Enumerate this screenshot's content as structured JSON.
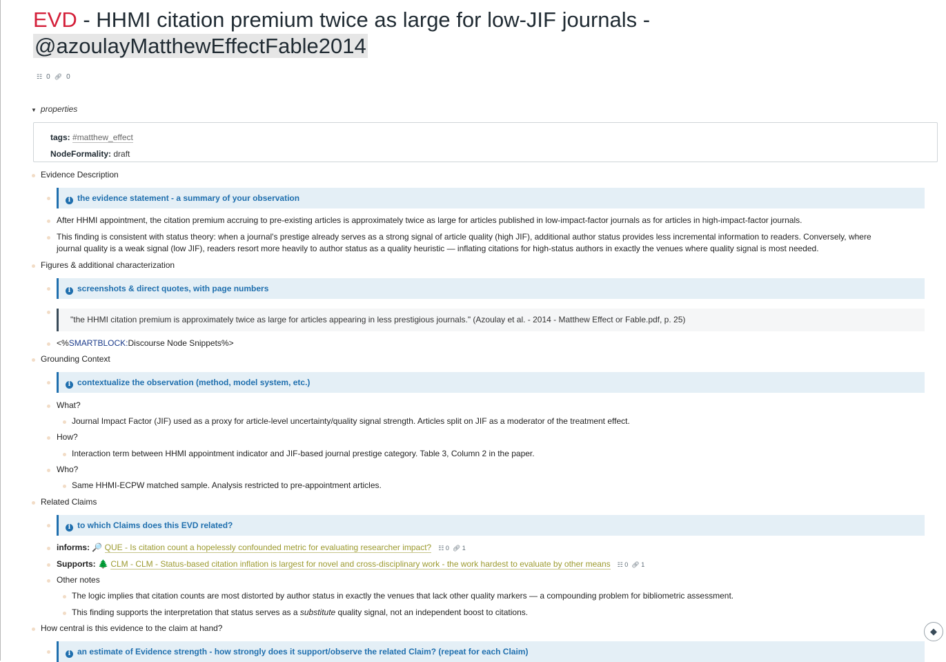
{
  "header": {
    "evd": "EVD",
    "title_rest": " - HHMI citation premium twice as large for low-JIF journals - ",
    "citation": "@azoulayMatthewEffectFable2014",
    "count_a": "0",
    "count_b": "0"
  },
  "properties": {
    "toggle_label": "properties",
    "tags_key": "tags:",
    "tags_value": "#matthew_effect",
    "formality_key": "NodeFormality:",
    "formality_value": "draft"
  },
  "evidence": {
    "heading": "Evidence Description",
    "callout": "the evidence statement - a summary of your observation",
    "p1": "After HHMI appointment, the citation premium accruing to pre-existing articles is approximately twice as large for articles published in low-impact-factor journals as for articles in high-impact-factor journals.",
    "p2a": "This finding is consistent with status theory: when a journal's prestige already serves as a strong signal of article quality (high JIF), additional author status provides less incremental information to readers. Conversely, where",
    "p2b": "journal quality is a weak signal (low JIF), readers resort more heavily to author status as a quality heuristic — inflating citations for high-status authors in exactly the venues where quality signal is most needed."
  },
  "figures": {
    "heading": "Figures & additional characterization",
    "callout": "screenshots & direct quotes, with page numbers",
    "quote": "\"the HHMI citation premium is approximately twice as large for articles appearing in less prestigious journals.\" (Azoulay et al. - 2014 - Matthew Effect or Fable.pdf, p. 25)",
    "smart_open": "<%",
    "smart_key": "SMARTBLOCK:",
    "smart_value": "Discourse Node Snippets",
    "smart_close": "%>"
  },
  "grounding": {
    "heading": "Grounding Context",
    "callout": "contextualize the observation (method, model system, etc.)",
    "what": "What?",
    "what_detail": "Journal Impact Factor (JIF) used as a proxy for article-level uncertainty/quality signal strength. Articles split on JIF as a moderator of the treatment effect.",
    "how": "How?",
    "how_detail": "Interaction term between HHMI appointment indicator and JIF-based journal prestige category. Table 3, Column 2 in the paper.",
    "who": "Who?",
    "who_detail": "Same HHMI-ECPW matched sample. Analysis restricted to pre-appointment articles."
  },
  "related": {
    "heading": "Related Claims",
    "callout": "to which Claims does this EVD related?",
    "informs_key": "informs:",
    "informs_emoji": "🔎",
    "informs_link": "QUE - Is citation count a hopelessly confounded metric for evaluating researcher impact?",
    "informs_c1": "0",
    "informs_c2": "1",
    "supports_key": "Supports:",
    "supports_emoji": "🌲",
    "supports_link": "CLM - CLM - Status-based citation inflation is largest for novel and cross-disciplinary work - the work hardest to evaluate by other means",
    "supports_c1": "0",
    "supports_c2": "1",
    "other_notes": "Other notes",
    "note1": "The logic implies that citation counts are most distorted by author status in exactly the venues that lack other quality markers — a compounding problem for bibliometric assessment.",
    "note2_a": "This finding supports the interpretation that status serves as a ",
    "note2_em": "substitute",
    "note2_b": " quality signal, not an independent boost to citations."
  },
  "centrality": {
    "heading": "How central is this evidence to the claim at hand?",
    "callout": "an estimate of Evidence strength - how strongly does it support/observe the related Claim? (repeat for each Claim)"
  }
}
